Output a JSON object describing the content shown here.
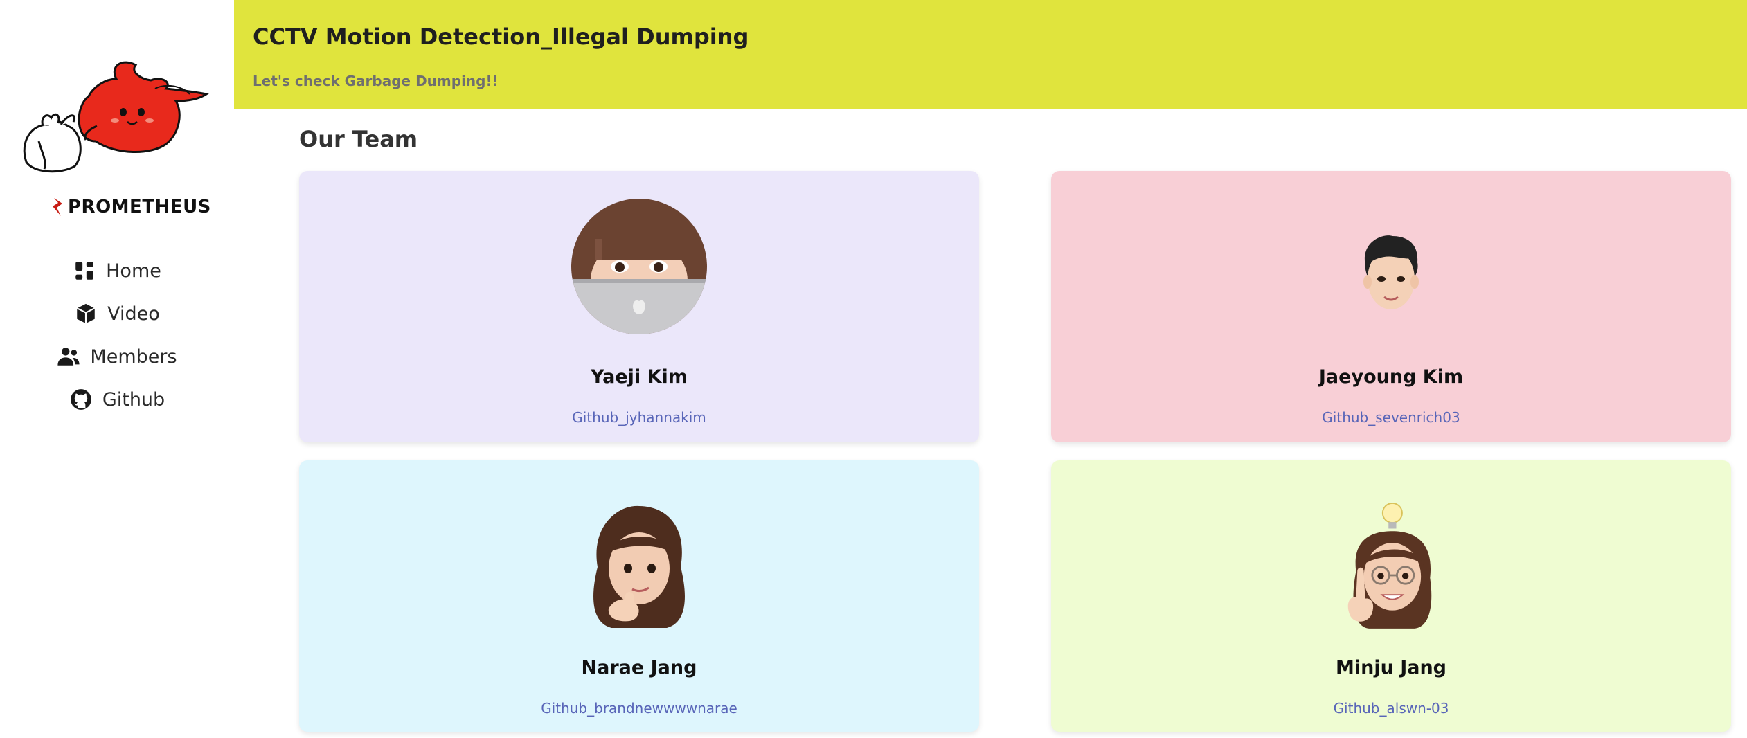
{
  "sidebar": {
    "brand": "PROMETHEUS",
    "nav": [
      {
        "label": "Home",
        "icon": "dashboard-icon"
      },
      {
        "label": "Video",
        "icon": "cube-icon"
      },
      {
        "label": "Members",
        "icon": "users-icon"
      },
      {
        "label": "Github",
        "icon": "github-icon"
      }
    ]
  },
  "header": {
    "title": "CCTV Motion Detection_Illegal Dumping",
    "subtitle": "Let's check Garbage Dumping!!",
    "color": "#e0e43d"
  },
  "main": {
    "section_title": "Our Team",
    "members": [
      {
        "name": "Yaeji Kim",
        "link": "Github_jyhannakim",
        "card_color": "#ebe7fa"
      },
      {
        "name": "Jaeyoung Kim",
        "link": "Github_sevenrich03",
        "card_color": "#f8cfd6"
      },
      {
        "name": "Narae Jang",
        "link": "Github_brandnewwwwnarae",
        "card_color": "#def6fd"
      },
      {
        "name": "Minju Jang",
        "link": "Github_alswn-03",
        "card_color": "#effcd2"
      }
    ]
  },
  "colors": {
    "link": "#5865b8",
    "mascot": "#e8291c"
  }
}
